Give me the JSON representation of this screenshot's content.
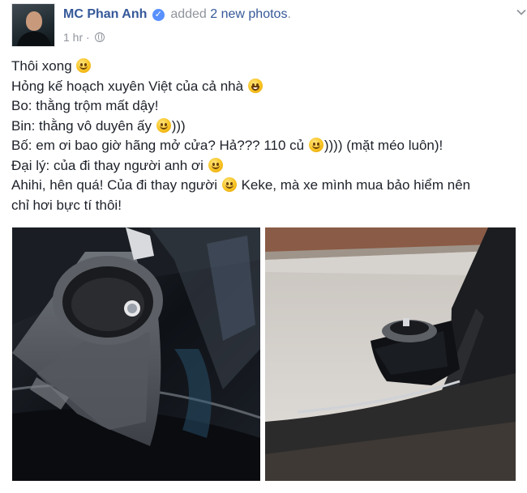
{
  "post": {
    "author": "MC Phan Anh",
    "verified_badge": "✓",
    "action_prefix": "added",
    "action_object": "2 new photos",
    "action_suffix": ".",
    "timestamp": "1 hr",
    "separator": "·",
    "privacy_icon": "globe-icon",
    "menu_icon": "chevron-down-icon"
  },
  "content": {
    "line1": "Thôi xong",
    "line2": "Hỏng kế hoạch xuyên Việt của cả nhà",
    "line3": "Bo: thằng trộm mất dậy!",
    "line4_a": "Bin: thằng vô duyên ấy",
    "line4_b": ")))",
    "line5_a": "Bố: em ơi bao giờ hãng mở cửa? Hả??? 110 củ",
    "line5_b": ")))) (mặt méo luôn)!",
    "line6": "Đại lý: của đi thay người anh ơi",
    "line7_a": "Ahihi, hên quá! Của đi thay người",
    "line7_b": "Keke, mà xe mình mua bảo hiểm nên",
    "line8": "chỉ hơi bực tí thôi!"
  },
  "photos": [
    {
      "description_icon": "photo-icon",
      "subject": "side-mirror-broken-closeup"
    },
    {
      "description_icon": "photo-icon",
      "subject": "side-mirror-broken-from-inside-car"
    }
  ],
  "colors": {
    "link": "#365899",
    "meta": "#90949c",
    "text": "#1d2129",
    "verified": "#5890ff"
  }
}
